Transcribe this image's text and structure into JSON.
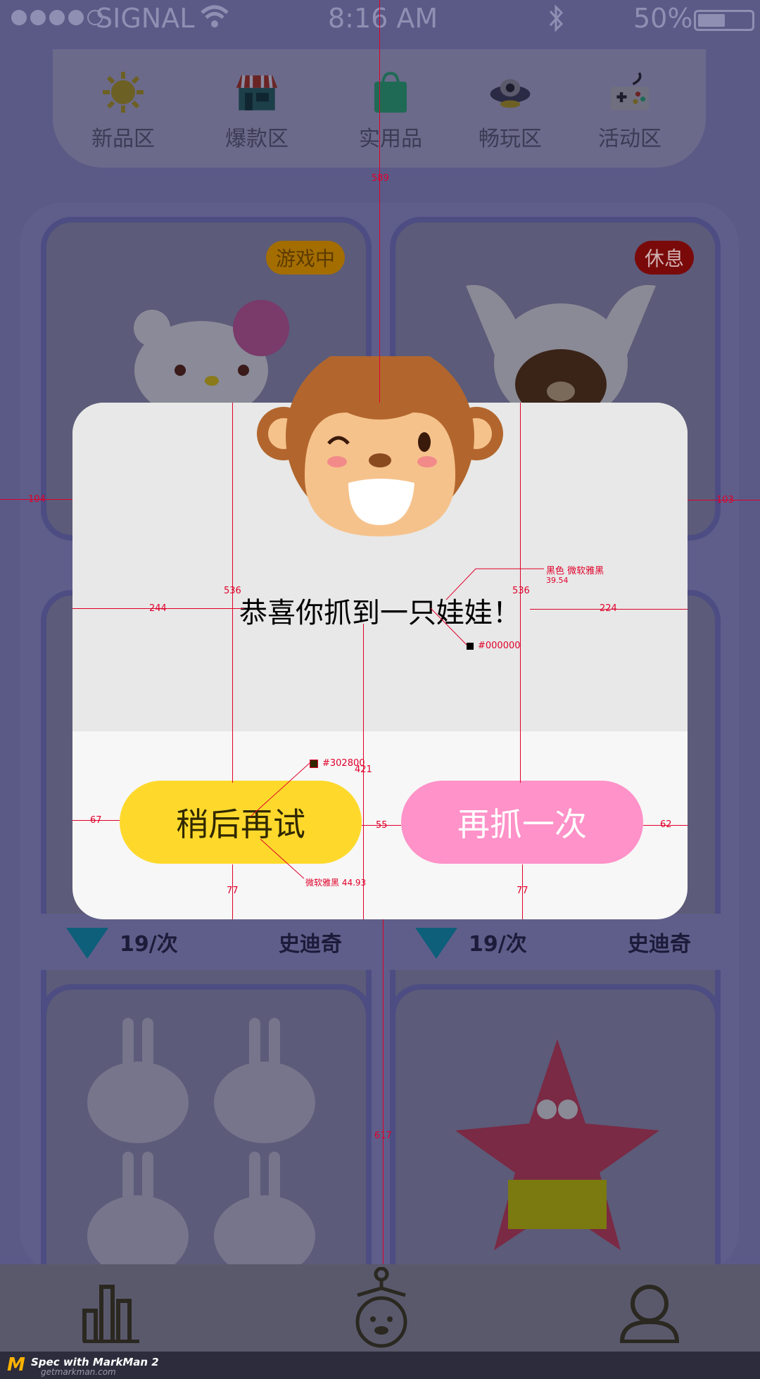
{
  "status_bar": {
    "carrier": "SIGNAL",
    "time": "8:16 AM",
    "battery": "50%",
    "battery_level": 0.5
  },
  "categories": [
    {
      "label": "新品区",
      "icon": "sun-icon"
    },
    {
      "label": "爆款区",
      "icon": "shop-icon"
    },
    {
      "label": "实用品",
      "icon": "shopping-bag-icon"
    },
    {
      "label": "畅玩区",
      "icon": "ufo-icon"
    },
    {
      "label": "活动区",
      "icon": "gamepad-icon"
    }
  ],
  "products": [
    {
      "badge": "游戏中",
      "badge_color": "#a36d00"
    },
    {
      "badge": "休息",
      "badge_color": "#7a0a0a"
    },
    {
      "price": "19/次",
      "name": "史迪奇"
    },
    {
      "price": "19/次",
      "name": "史迪奇"
    }
  ],
  "dialog": {
    "message": "恭喜你抓到一只娃娃！",
    "later_button": "稍后再试",
    "again_button": "再抓一次"
  },
  "annotations": {
    "m_589": "589",
    "m_104": "104",
    "m_103": "103",
    "m_536a": "536",
    "m_536b": "536",
    "m_244": "244",
    "m_224": "224",
    "m_421": "421",
    "m_67": "67",
    "m_55": "55",
    "m_62": "62",
    "m_77a": "77",
    "m_77b": "77",
    "m_617": "617",
    "font_note_1": "黑色  微软雅黑",
    "font_size_1": "39.54",
    "color_note_1": "#000000",
    "color_note_2": "#302800",
    "font_note_2": "微软雅黑 44.93"
  },
  "branding": {
    "text": "Spec with MarkMan 2",
    "url": "getmarkman.com"
  },
  "colors": {
    "accent_yellow": "#fed92c",
    "accent_pink": "#ff92c8",
    "dialog_text": "#000000",
    "later_text": "#302800"
  }
}
